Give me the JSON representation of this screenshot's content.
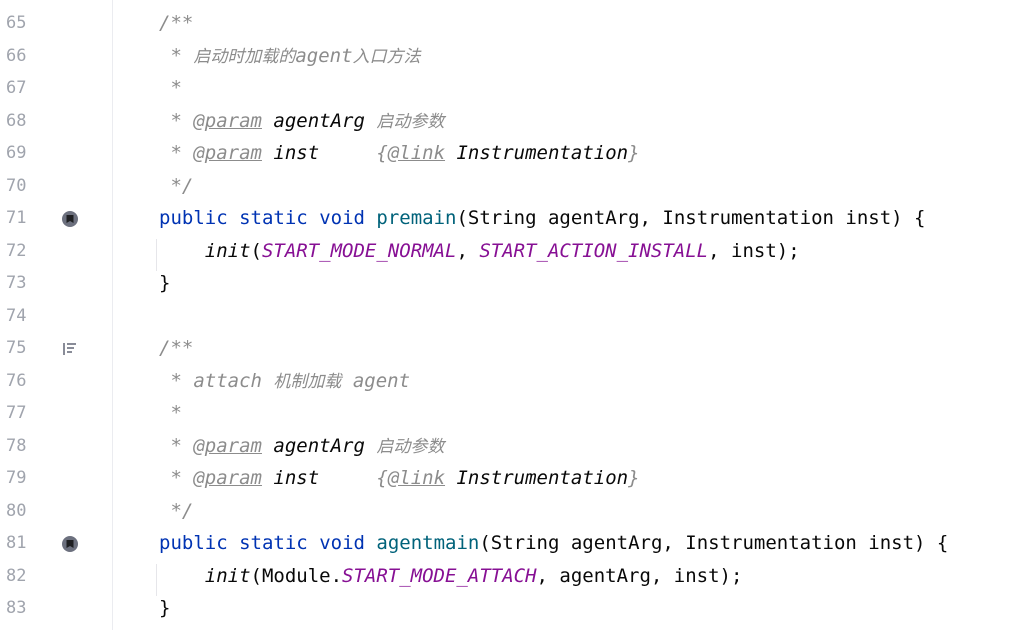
{
  "lines": [
    {
      "num": "65",
      "parts": [
        {
          "t": "/**",
          "c": "cmt"
        }
      ]
    },
    {
      "num": "66",
      "parts": [
        {
          "t": " * ",
          "c": "cmt"
        },
        {
          "t": "启动时加载的",
          "c": "cmt cn"
        },
        {
          "t": "agent",
          "c": "cmt"
        },
        {
          "t": "入口方法",
          "c": "cmt cn"
        }
      ]
    },
    {
      "num": "67",
      "parts": [
        {
          "t": " *",
          "c": "cmt"
        }
      ]
    },
    {
      "num": "68",
      "parts": [
        {
          "t": " * ",
          "c": "cmt"
        },
        {
          "t": "@param",
          "c": "tag"
        },
        {
          "t": " ",
          "c": "cmt"
        },
        {
          "t": "agentArg",
          "c": "docref"
        },
        {
          "t": " ",
          "c": "cmt"
        },
        {
          "t": "启动参数",
          "c": "cmt cn"
        }
      ]
    },
    {
      "num": "69",
      "parts": [
        {
          "t": " * ",
          "c": "cmt"
        },
        {
          "t": "@param",
          "c": "tag"
        },
        {
          "t": " ",
          "c": "cmt"
        },
        {
          "t": "inst",
          "c": "docref"
        },
        {
          "t": "     {",
          "c": "cmt"
        },
        {
          "t": "@link",
          "c": "tag"
        },
        {
          "t": " ",
          "c": "cmt"
        },
        {
          "t": "Instrumentation",
          "c": "docref"
        },
        {
          "t": "}",
          "c": "cmt"
        }
      ]
    },
    {
      "num": "70",
      "parts": [
        {
          "t": " */",
          "c": "cmt"
        }
      ]
    },
    {
      "num": "71",
      "marker": "implementation-icon",
      "parts": [
        {
          "t": "public",
          "c": "kw"
        },
        {
          "t": " ",
          "c": "plain"
        },
        {
          "t": "static",
          "c": "kw"
        },
        {
          "t": " ",
          "c": "plain"
        },
        {
          "t": "void",
          "c": "kw"
        },
        {
          "t": " ",
          "c": "plain"
        },
        {
          "t": "premain",
          "c": "fn"
        },
        {
          "t": "(String agentArg, Instrumentation inst) {",
          "c": "plain"
        }
      ]
    },
    {
      "num": "72",
      "parts": [
        {
          "t": "    ",
          "c": "plain"
        },
        {
          "t": "init",
          "c": "call"
        },
        {
          "t": "(",
          "c": "plain"
        },
        {
          "t": "START_MODE_NORMAL",
          "c": "const"
        },
        {
          "t": ", ",
          "c": "plain"
        },
        {
          "t": "START_ACTION_INSTALL",
          "c": "const"
        },
        {
          "t": ", inst);",
          "c": "plain"
        }
      ]
    },
    {
      "num": "73",
      "parts": [
        {
          "t": "}",
          "c": "plain"
        }
      ]
    },
    {
      "num": "74",
      "parts": []
    },
    {
      "num": "75",
      "marker": "rendered-doc-icon",
      "parts": [
        {
          "t": "/**",
          "c": "cmt"
        }
      ]
    },
    {
      "num": "76",
      "parts": [
        {
          "t": " * attach ",
          "c": "cmt"
        },
        {
          "t": "机制加载",
          "c": "cmt cn"
        },
        {
          "t": " agent",
          "c": "cmt"
        }
      ]
    },
    {
      "num": "77",
      "parts": [
        {
          "t": " *",
          "c": "cmt"
        }
      ]
    },
    {
      "num": "78",
      "parts": [
        {
          "t": " * ",
          "c": "cmt"
        },
        {
          "t": "@param",
          "c": "tag"
        },
        {
          "t": " ",
          "c": "cmt"
        },
        {
          "t": "agentArg",
          "c": "docref"
        },
        {
          "t": " ",
          "c": "cmt"
        },
        {
          "t": "启动参数",
          "c": "cmt cn"
        }
      ]
    },
    {
      "num": "79",
      "parts": [
        {
          "t": " * ",
          "c": "cmt"
        },
        {
          "t": "@param",
          "c": "tag"
        },
        {
          "t": " ",
          "c": "cmt"
        },
        {
          "t": "inst",
          "c": "docref"
        },
        {
          "t": "     {",
          "c": "cmt"
        },
        {
          "t": "@link",
          "c": "tag"
        },
        {
          "t": " ",
          "c": "cmt"
        },
        {
          "t": "Instrumentation",
          "c": "docref"
        },
        {
          "t": "}",
          "c": "cmt"
        }
      ]
    },
    {
      "num": "80",
      "parts": [
        {
          "t": " */",
          "c": "cmt"
        }
      ]
    },
    {
      "num": "81",
      "marker": "implementation-icon",
      "parts": [
        {
          "t": "public",
          "c": "kw"
        },
        {
          "t": " ",
          "c": "plain"
        },
        {
          "t": "static",
          "c": "kw"
        },
        {
          "t": " ",
          "c": "plain"
        },
        {
          "t": "void",
          "c": "kw"
        },
        {
          "t": " ",
          "c": "plain"
        },
        {
          "t": "agentmain",
          "c": "fn"
        },
        {
          "t": "(String agentArg, Instrumentation inst) {",
          "c": "plain"
        }
      ]
    },
    {
      "num": "82",
      "parts": [
        {
          "t": "    ",
          "c": "plain"
        },
        {
          "t": "init",
          "c": "call"
        },
        {
          "t": "(Module.",
          "c": "plain"
        },
        {
          "t": "START_MODE_ATTACH",
          "c": "const"
        },
        {
          "t": ", agentArg, inst);",
          "c": "plain"
        }
      ]
    },
    {
      "num": "83",
      "parts": [
        {
          "t": "}",
          "c": "plain"
        }
      ]
    }
  ]
}
